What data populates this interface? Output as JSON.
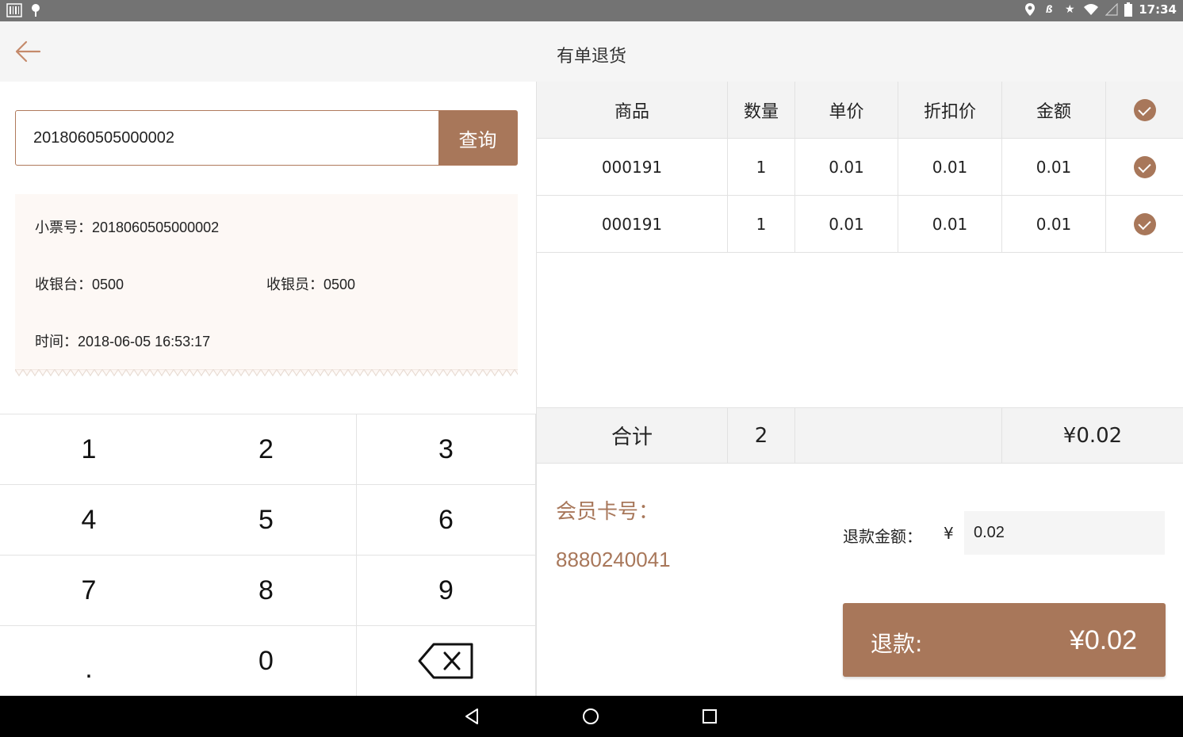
{
  "status_bar": {
    "time": "17:34",
    "left_icons": [
      "barcode-icon",
      "notification-icon"
    ],
    "right_icons": [
      "location-icon",
      "bluetooth-icon",
      "star-icon",
      "wifi-icon",
      "signal-icon",
      "battery-icon"
    ]
  },
  "header": {
    "title": "有单退货",
    "back_icon": "back-arrow-icon"
  },
  "search": {
    "value": "2018060505000002",
    "button_label": "查询"
  },
  "receipt": {
    "ticket_label": "小票号：",
    "ticket_value": "2018060505000002",
    "register_label": "收银台：",
    "register_value": "0500",
    "cashier_label": "收银员：",
    "cashier_value": "0500",
    "time_label": "时间：",
    "time_value": "2018-06-05 16:53:17"
  },
  "keypad": {
    "keys": [
      "1",
      "2",
      "3",
      "4",
      "5",
      "6",
      "7",
      "8",
      "9",
      ".",
      "0"
    ],
    "backspace_icon": "backspace-icon"
  },
  "table": {
    "headers": [
      "商品",
      "数量",
      "单价",
      "折扣价",
      "金额"
    ],
    "rows": [
      {
        "product": "000191",
        "qty": "1",
        "unit_price": "0.01",
        "discount_price": "0.01",
        "amount": "0.01",
        "checked": true
      },
      {
        "product": "000191",
        "qty": "1",
        "unit_price": "0.01",
        "discount_price": "0.01",
        "amount": "0.01",
        "checked": true
      }
    ]
  },
  "total": {
    "label": "合计",
    "qty": "2",
    "amount": "¥0.02"
  },
  "member": {
    "label": "会员卡号：",
    "value": "8880240041"
  },
  "refund": {
    "label": "退款金额：",
    "currency": "¥",
    "amount_value": "0.02",
    "button_label": "退款:",
    "button_amount": "¥0.02"
  },
  "colors": {
    "accent": "#a8775a",
    "receipt_bg": "#fdf8f5"
  },
  "nav_bar": {
    "icons": [
      "nav-back-icon",
      "nav-home-icon",
      "nav-recents-icon"
    ]
  }
}
